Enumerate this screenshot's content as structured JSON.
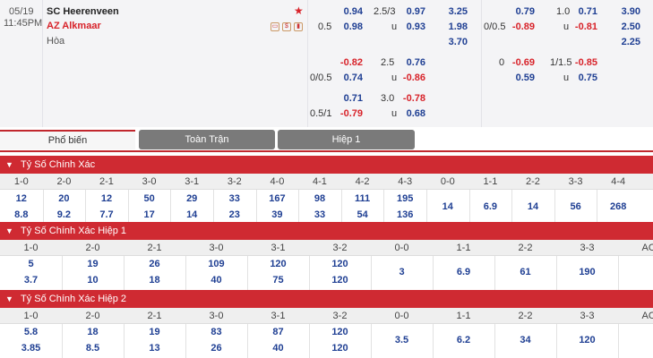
{
  "match": {
    "date": "05/19",
    "time": "11:45PM",
    "home": "SC Heerenveen",
    "away": "AZ Alkmaar",
    "draw": "Hòa"
  },
  "odds": {
    "ft_hdp": [
      {
        "line": "",
        "home": "0.94",
        "away": "0.98",
        "away_line": "0.5"
      },
      {
        "line": "0/0.5",
        "home": "-0.82",
        "away": "0.74"
      },
      {
        "line": "0.5/1",
        "home": "0.71",
        "away": "-0.79"
      }
    ],
    "ft_ou": [
      {
        "line": "2.5/3",
        "over": "0.97",
        "under": "0.93",
        "u": "u"
      },
      {
        "line": "2.5",
        "over": "0.76",
        "under": "-0.86",
        "u": "u"
      },
      {
        "line": "3.0",
        "over": "-0.78",
        "under": "0.68",
        "u": "u"
      }
    ],
    "ft_1x2": [
      "3.25",
      "1.98",
      "3.70"
    ],
    "h1_hdp": [
      {
        "line": "0/0.5",
        "home": "0.79",
        "away": "-0.89"
      },
      {
        "line": "0",
        "home": "-0.69",
        "away": "0.59"
      }
    ],
    "h1_ou": [
      {
        "line": "1.0",
        "over": "0.71",
        "under": "-0.81",
        "u": "u"
      },
      {
        "line": "1/1.5",
        "over": "-0.85",
        "under": "0.75",
        "u": "u"
      }
    ],
    "h1_1x2": [
      "3.90",
      "2.50",
      "2.25"
    ]
  },
  "tabs": [
    "Phổ biến",
    "Toàn Trận",
    "Hiệp 1"
  ],
  "sections": [
    {
      "title": "Tỷ Số Chính Xác",
      "headers": [
        "1-0",
        "2-0",
        "2-1",
        "3-0",
        "3-1",
        "3-2",
        "4-0",
        "4-1",
        "4-2",
        "4-3",
        "0-0",
        "1-1",
        "2-2",
        "3-3",
        "4-4"
      ],
      "top": [
        "12",
        "20",
        "12",
        "50",
        "29",
        "33",
        "167",
        "98",
        "111",
        "195",
        "14",
        "6.9",
        "14",
        "56",
        "268"
      ],
      "bottom": [
        "8.8",
        "9.2",
        "7.7",
        "17",
        "14",
        "23",
        "39",
        "33",
        "54",
        "136"
      ]
    },
    {
      "title": "Tỷ Số Chính Xác Hiệp 1",
      "headers": [
        "1-0",
        "2-0",
        "2-1",
        "3-0",
        "3-1",
        "3-2",
        "0-0",
        "1-1",
        "2-2",
        "3-3",
        "AO"
      ],
      "top": [
        "5",
        "19",
        "26",
        "109",
        "120",
        "120",
        "3",
        "6.9",
        "61",
        "190"
      ],
      "bottom": [
        "3.7",
        "10",
        "18",
        "40",
        "75",
        "120"
      ]
    },
    {
      "title": "Tỷ Số Chính Xác Hiệp 2",
      "headers": [
        "1-0",
        "2-0",
        "2-1",
        "3-0",
        "3-1",
        "3-2",
        "0-0",
        "1-1",
        "2-2",
        "3-3",
        "AO"
      ],
      "top": [
        "5.8",
        "18",
        "19",
        "83",
        "87",
        "120",
        "3.5",
        "6.2",
        "34",
        "120"
      ],
      "bottom": [
        "3.85",
        "8.5",
        "13",
        "26",
        "40",
        "120"
      ]
    }
  ]
}
